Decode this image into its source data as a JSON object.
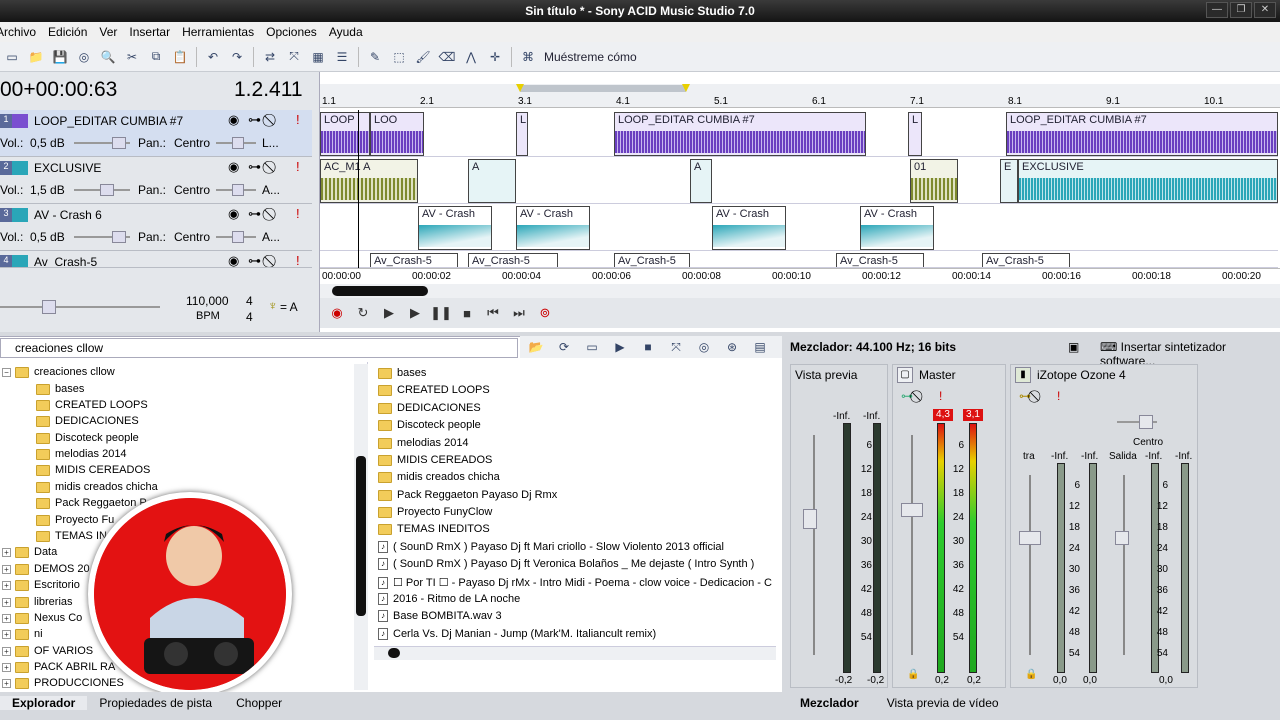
{
  "window": {
    "title": "Sin título * - Sony ACID Music Studio 7.0"
  },
  "menu": [
    "Archivo",
    "Edición",
    "Ver",
    "Insertar",
    "Herramientas",
    "Opciones",
    "Ayuda"
  ],
  "toolbar": {
    "show_me": "Muéstreme cómo"
  },
  "position": {
    "timecode": "00+00:00:63",
    "beat": "1.2.411"
  },
  "tracks": [
    {
      "name": "LOOP_EDITAR CUMBIA #7",
      "vol_label": "Vol.:",
      "vol": "0,5 dB",
      "pan_label": "Pan.:",
      "pan": "Centro",
      "fx": "L...",
      "color": "#7a4fd0"
    },
    {
      "name": "EXCLUSIVE",
      "vol_label": "Vol.:",
      "vol": "1,5 dB",
      "pan_label": "Pan.:",
      "pan": "Centro",
      "fx": "A...",
      "color": "#2aa6b8"
    },
    {
      "name": "AV - Crash 6",
      "vol_label": "Vol.:",
      "vol": "0,5 dB",
      "pan_label": "Pan.:",
      "pan": "Centro",
      "fx": "A...",
      "color": "#2aa6b8"
    },
    {
      "name": "Av_Crash-5",
      "color": "#2aa6b8"
    }
  ],
  "ruler": [
    "1.1",
    "2.1",
    "3.1",
    "4.1",
    "5.1",
    "6.1",
    "7.1",
    "8.1",
    "9.1",
    "10.1"
  ],
  "time_ruler": [
    "00:00:00",
    "00:00:02",
    "00:00:04",
    "00:00:06",
    "00:00:08",
    "00:00:10",
    "00:00:12",
    "00:00:14",
    "00:00:16",
    "00:00:18",
    "00:00:20"
  ],
  "clips": {
    "loop1": "LOOP",
    "loop2": "LOO",
    "loop_l": "L",
    "loop_big": "LOOP_EDITAR CUMBIA #7",
    "ac": "AC_M1 A",
    "a": "A",
    "o1": "01",
    "e": "E",
    "exclusive": "EXCLUSIVE",
    "crash": "AV - Crash",
    "crash5": "Av_Crash-5"
  },
  "tempo": {
    "bpm": "110,000",
    "bpm_label": "BPM",
    "sig_top": "4",
    "sig_bottom": "4",
    "key": "= A"
  },
  "explorer": {
    "address": "creaciones cllow",
    "tree_root": "creaciones cllow",
    "tree_children": [
      "bases",
      "CREATED LOOPS",
      "DEDICACIONES",
      "Discoteck people",
      "melodias 2014",
      "MIDIS CEREADOS",
      "midis creados chicha",
      "Pack Reggaeton P",
      "Proyecto Fu",
      "TEMAS IN"
    ],
    "tree_others": [
      "Data",
      "DEMOS 20",
      "Escritorio",
      "librerias",
      "Nexus Co",
      "ni",
      "OF VARIOS",
      "PACK ABRIL RA",
      "PRODUCCIONES"
    ],
    "folders": [
      "bases",
      "CREATED LOOPS",
      "DEDICACIONES",
      "Discoteck people",
      "melodias 2014",
      "MIDIS CEREADOS",
      "midis creados chicha",
      "Pack Reggaeton Payaso Dj Rmx",
      "Proyecto FunyClow",
      "TEMAS INEDITOS"
    ],
    "files": [
      "( SounD RmX ) Payaso Dj ft Mari criollo  - Slow Violento 2013 official",
      "( SounD RmX ) Payaso Dj ft Veronica Bolaños _ Me dejaste ( Intro Synth )",
      "☐ Por TI ☐ -  Payaso Dj rMx -  Intro Midi - Poema - clow voice - Dedicacion - C",
      "2016 - Ritmo de  LA noche",
      "Base BOMBITA.wav 3",
      "Cerla Vs. Dj Manian - Jump (Mark'M. Italiancult remix)"
    ]
  },
  "bottom_tabs": [
    "Explorador",
    "Propiedades de pista",
    "Chopper"
  ],
  "mixer": {
    "header": "Mezclador: 44.100 Hz; 16 bits",
    "insert": "Insertar sintetizador software...",
    "preview": "Vista previa",
    "master": "Master",
    "ozone": "iZotope Ozone 4",
    "center": "Centro",
    "tra": "tra",
    "salida": "Salida",
    "inf": "-Inf.",
    "scale": [
      "6",
      "12",
      "18",
      "24",
      "30",
      "36",
      "42",
      "48",
      "54"
    ],
    "peak_l": "4,3",
    "peak_r": "3,1",
    "val_preview": "-0,2",
    "val_master": "0,2",
    "val_zero": "0,0"
  },
  "mixer_tabs": [
    "Mezclador",
    "Vista previa de vídeo"
  ],
  "colors": {
    "purple": "#7a4fd0",
    "teal": "#2aa6b8",
    "green": "#7e8a2e",
    "red": "#e31212"
  }
}
